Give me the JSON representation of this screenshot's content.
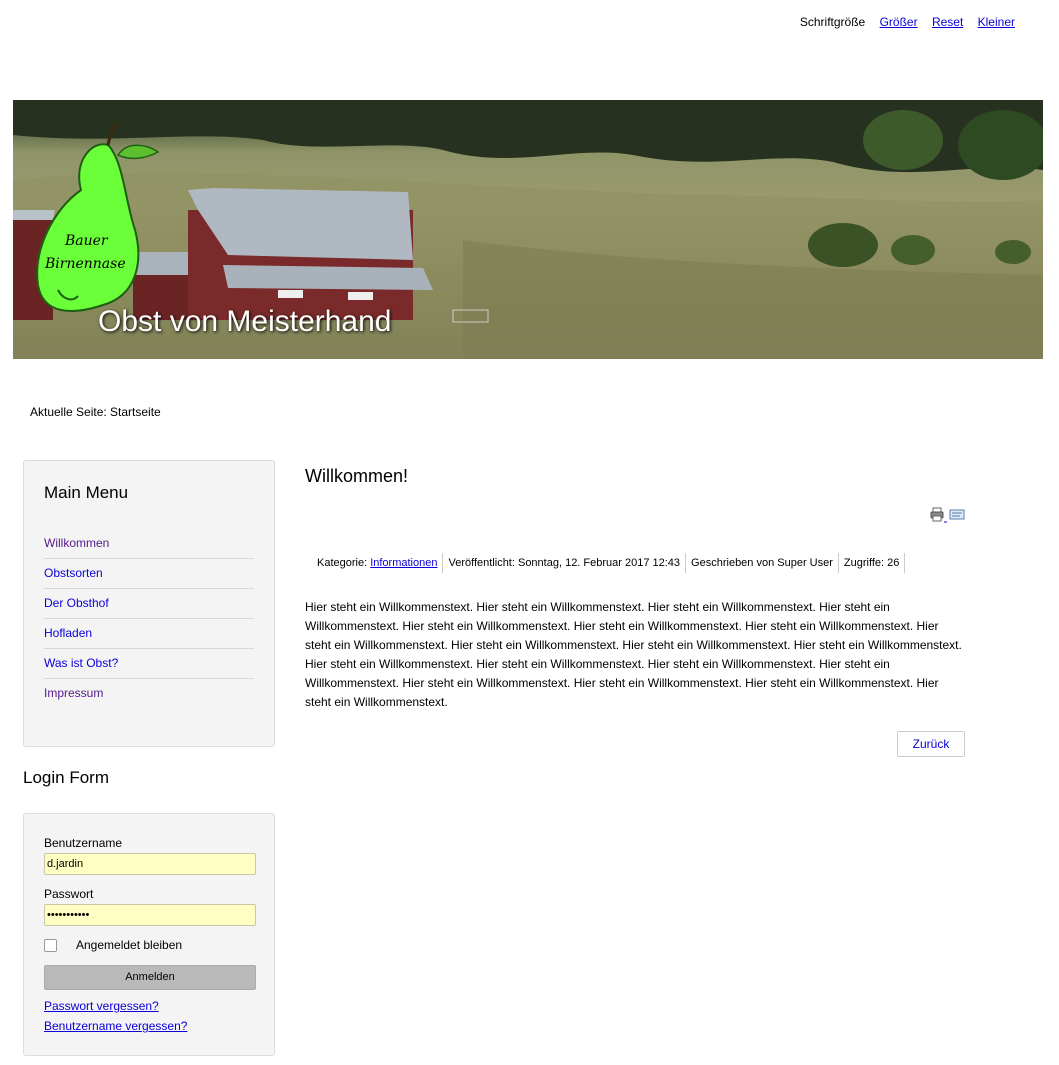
{
  "font_size_bar": {
    "label": "Schriftgröße",
    "bigger": "Größer",
    "reset": "Reset",
    "smaller": "Kleiner"
  },
  "header": {
    "logo_line1": "Bauer",
    "logo_line2": "Birnennase",
    "site_title": "Obst von Meisterhand"
  },
  "breadcrumb": "Aktuelle Seite: Startseite",
  "main_menu": {
    "title": "Main Menu",
    "items": [
      "Willkommen",
      "Obstsorten",
      "Der Obsthof",
      "Hofladen",
      "Was ist Obst?",
      "Impressum"
    ]
  },
  "login": {
    "heading": "Login Form",
    "username_label": "Benutzername",
    "username_value": "d.jardin",
    "password_label": "Passwort",
    "password_value": "•••••••••••",
    "remember_label": "Angemeldet bleiben",
    "submit_label": "Anmelden",
    "forgot_password": "Passwort vergessen?",
    "forgot_username": "Benutzername vergessen?"
  },
  "article": {
    "title": "Willkommen!",
    "category_label": "Kategorie: ",
    "category_link": "Informationen",
    "published": "Veröffentlicht: Sonntag, 12. Februar 2017 12:43",
    "author": "Geschrieben von Super User",
    "hits": "Zugriffe: 26",
    "body": "Hier steht ein Willkommenstext. Hier steht ein Willkommenstext. Hier steht ein Willkommenstext. Hier steht ein Willkommenstext. Hier steht ein Willkommenstext. Hier steht ein Willkommenstext. Hier steht ein Willkommenstext. Hier steht ein Willkommenstext. Hier steht ein Willkommenstext. Hier steht ein Willkommenstext. Hier steht ein Willkommenstext. Hier steht ein Willkommenstext. Hier steht ein Willkommenstext. Hier steht ein Willkommenstext. Hier steht ein Willkommenstext. Hier steht ein Willkommenstext. Hier steht ein Willkommenstext. Hier steht ein Willkommenstext. Hier steht ein Willkommenstext.",
    "back_label": "Zurück"
  },
  "colors": {
    "link": "#0b00d8",
    "pear_green": "#6bff3a",
    "input_bg": "#ffffc4"
  }
}
